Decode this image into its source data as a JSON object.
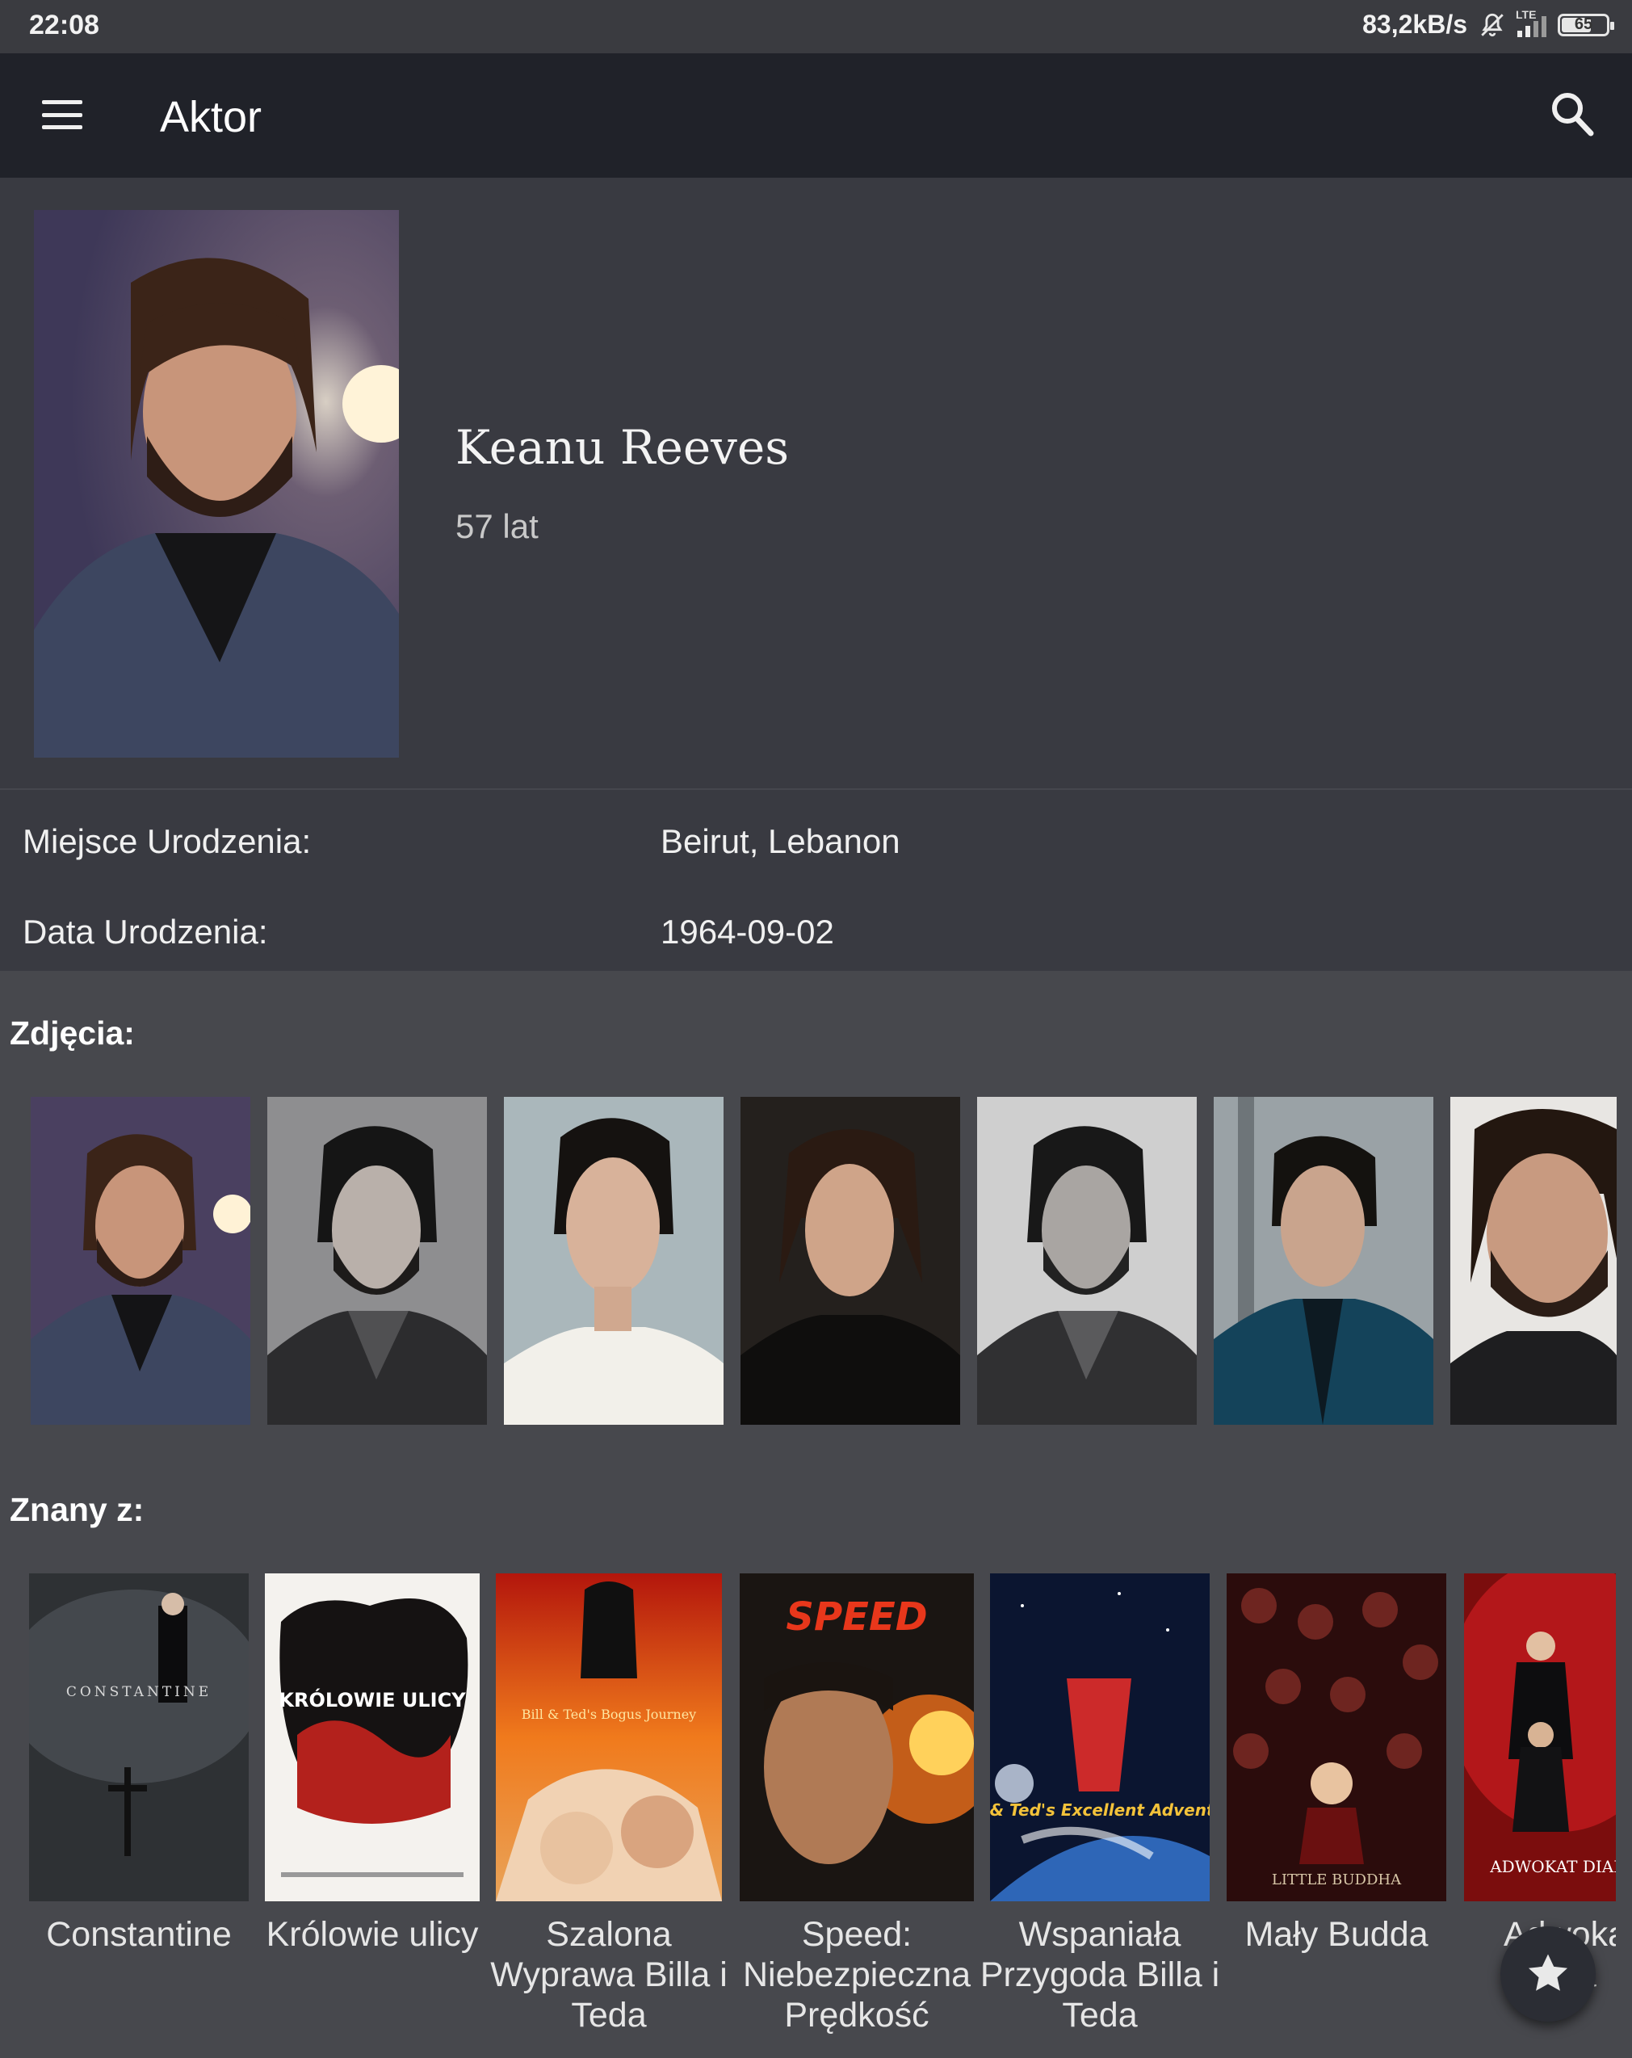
{
  "status_bar": {
    "time": "22:08",
    "network_speed": "83,2kB/s",
    "network_type": "LTE",
    "battery": "65"
  },
  "app_bar": {
    "title": "Aktor"
  },
  "actor": {
    "name": "Keanu Reeves",
    "age": "57 lat"
  },
  "details": [
    {
      "label": "Miejsce Urodzenia:",
      "value": "Beirut, Lebanon"
    },
    {
      "label": "Data Urodzenia:",
      "value": "1964-09-02"
    }
  ],
  "photos_section": {
    "title": "Zdjęcia:"
  },
  "known_for_section": {
    "title": "Znany z:"
  },
  "movies": [
    {
      "title": "Constantine",
      "poster_text": "CONSTANTINE"
    },
    {
      "title": "Królowie ulicy",
      "poster_text": "KRÓLOWIE ULICY"
    },
    {
      "title": "Szalona Wyprawa Billa i Teda",
      "poster_text": "Bill & Ted's Bogus Journey"
    },
    {
      "title": "Speed: Niebezpieczna Prędkość",
      "poster_text": "SPEED"
    },
    {
      "title": "Wspaniała Przygoda Billa i Teda",
      "poster_text": "Bill & Ted's Excellent Adventure"
    },
    {
      "title": "Mały Budda",
      "poster_text": "LITTLE BUDDHA"
    },
    {
      "title": "Adwokat diabła",
      "poster_text": "ADWOKAT DIABŁA"
    }
  ],
  "icons": {
    "menu": "menu-icon",
    "search": "search-icon",
    "fab": "star-icon",
    "mute": "bell-off-icon"
  },
  "colors": {
    "background": "#47484d",
    "app_bar": "#202229",
    "panel": "#393a41",
    "status_bar": "#3a3b40"
  }
}
